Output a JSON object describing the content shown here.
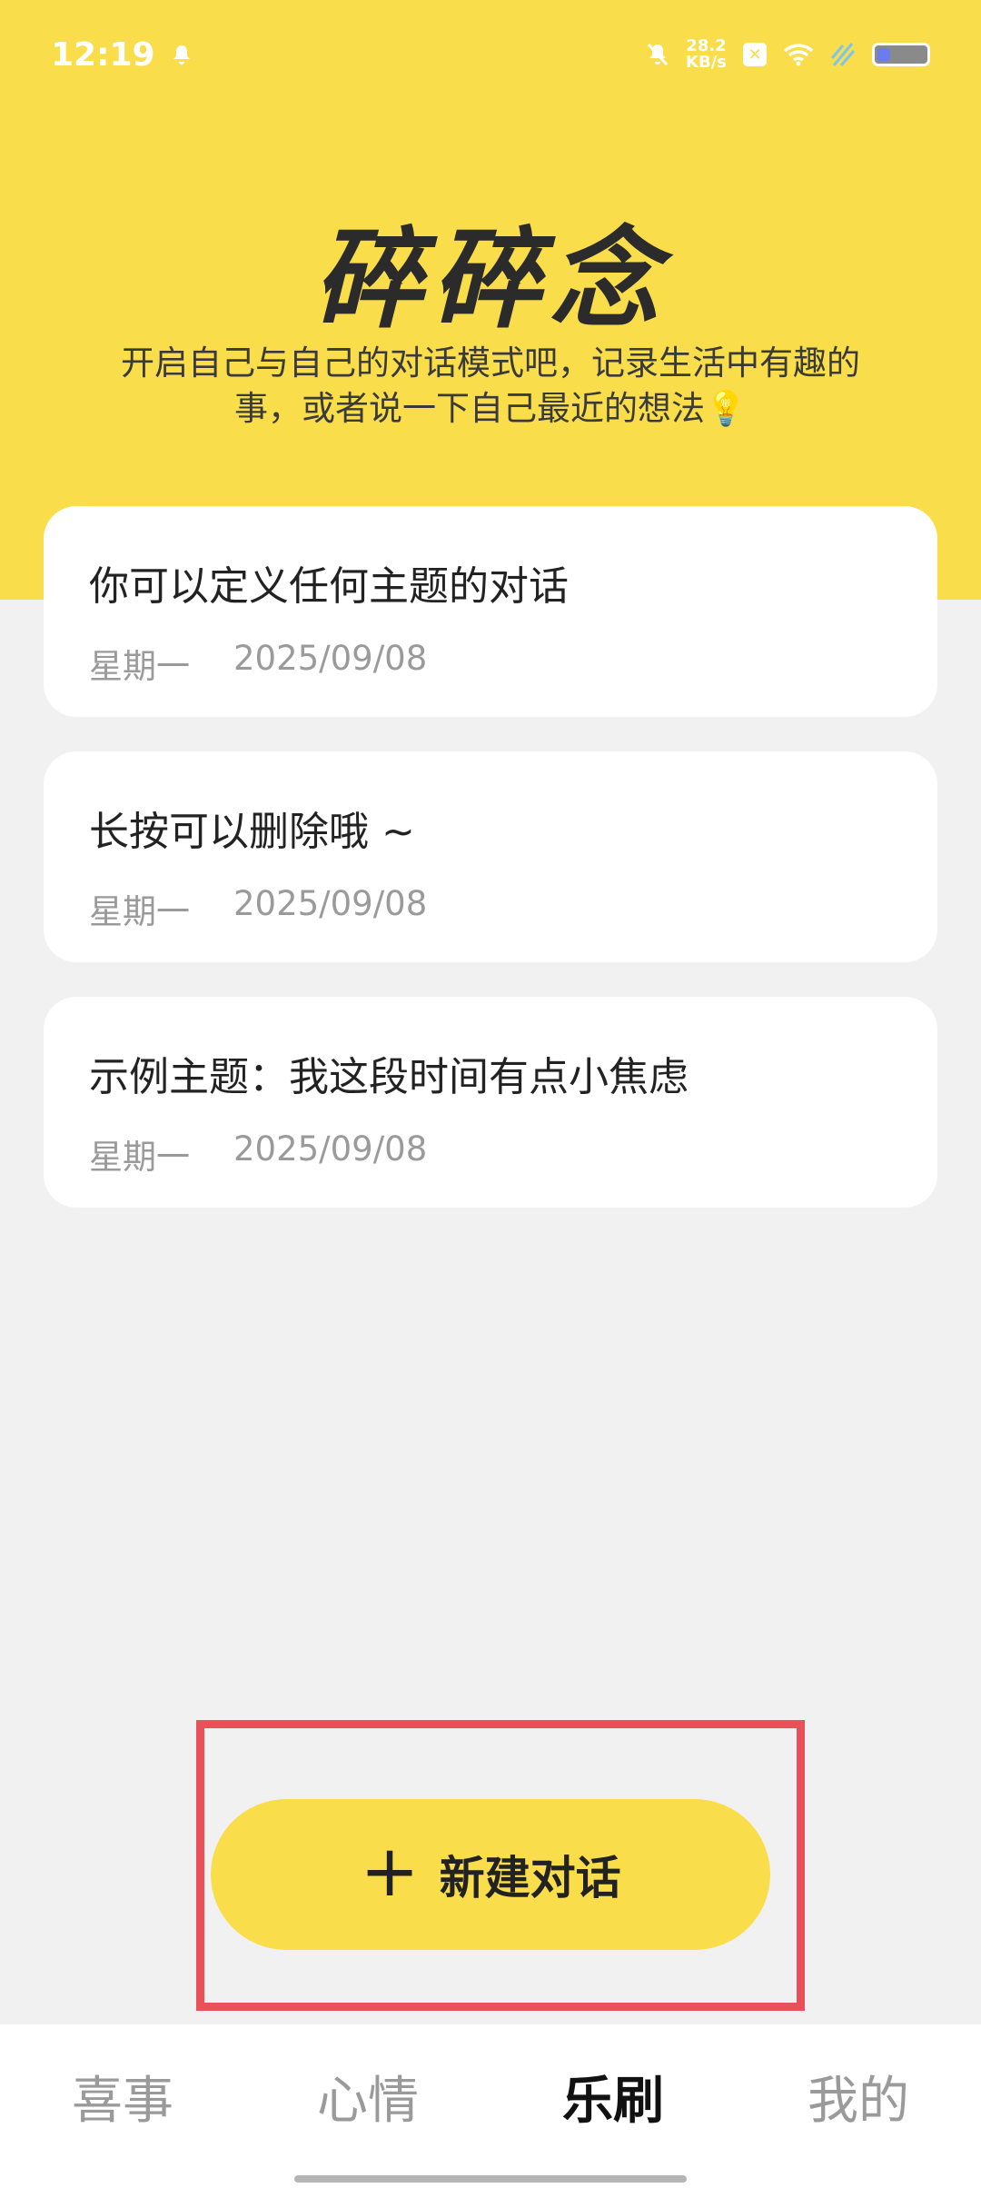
{
  "status": {
    "time": "12:19",
    "speed_value": "28.2",
    "speed_unit": "KB/s"
  },
  "header": {
    "title": "碎碎念",
    "subtitle": "开启自己与自己的对话模式吧，记录生活中有趣的事，或者说一下自己最近的想法💡"
  },
  "conversations": [
    {
      "title": "你可以定义任何主题的对话",
      "weekday": "星期一",
      "date": "2025/09/08"
    },
    {
      "title": "长按可以删除哦 ~",
      "weekday": "星期一",
      "date": "2025/09/08"
    },
    {
      "title": "示例主题：我这段时间有点小焦虑",
      "weekday": "星期一",
      "date": "2025/09/08"
    }
  ],
  "new_conversation": {
    "icon": "+",
    "label": "新建对话"
  },
  "tabs": [
    {
      "label": "喜事"
    },
    {
      "label": "心情"
    },
    {
      "label": "乐刷"
    },
    {
      "label": "我的"
    }
  ],
  "colors": {
    "accent": "#f9dd4a",
    "highlight": "#e9505a",
    "background": "#f2f1f1"
  }
}
